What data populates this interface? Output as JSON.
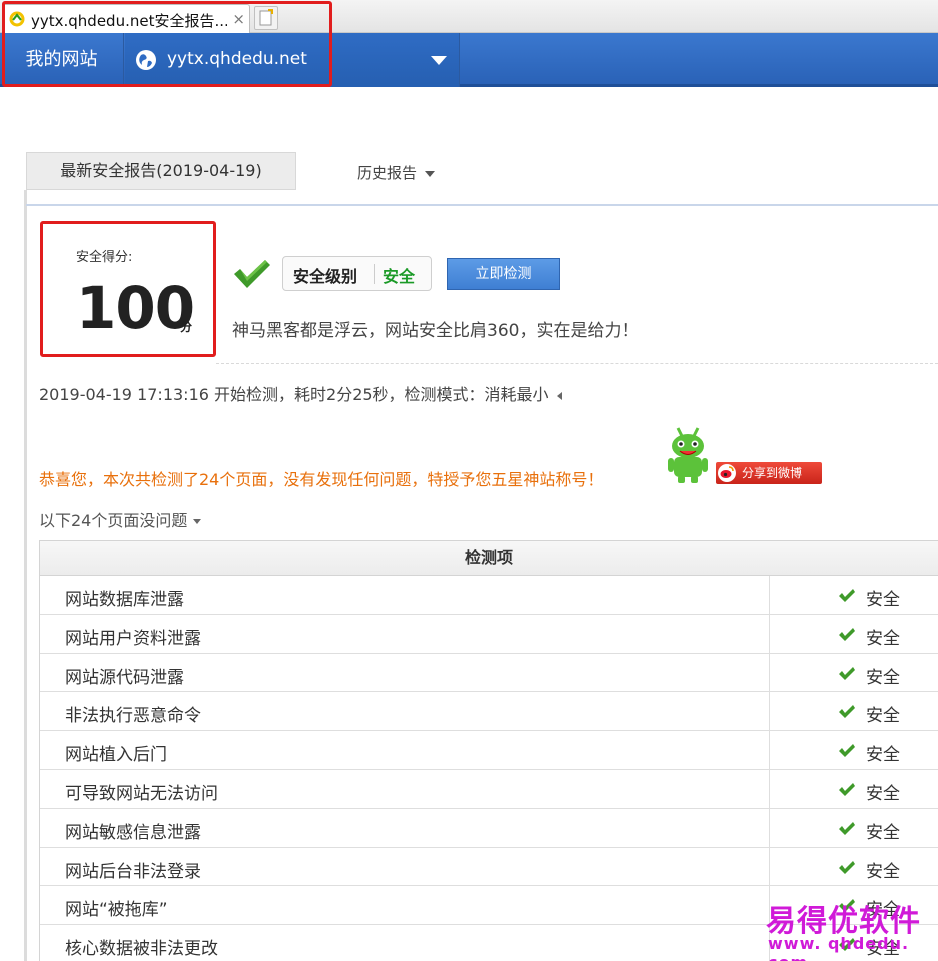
{
  "browser": {
    "tab_title": "yytx.qhdedu.net安全报告...",
    "tab_close": "×"
  },
  "sitebar": {
    "my_site": "我的网站",
    "domain": "yytx.qhdedu.net"
  },
  "report": {
    "latest_tab": "最新安全报告(2019-04-19)",
    "history_tab": "历史报告"
  },
  "score": {
    "label": "安全得分:",
    "value": "100",
    "unit": "分",
    "level_name": "安全级别",
    "level_value": "安全",
    "scan_button": "立即检测",
    "slogan": "神马黑客都是浮云，网站安全比肩360，实在是给力！",
    "level_color": "#1b9a27"
  },
  "scan_info": "2019-04-19 17:13:16 开始检测，耗时2分25秒，检测模式：消耗最小",
  "congrats": "恭喜您，本次共检测了24个页面，没有发现任何问题，特授予您五星神站称号！",
  "share_button": "分享到微博",
  "pages_ok": "以下24个页面没问题",
  "table": {
    "header": "检测项",
    "rows": [
      {
        "name": "网站数据库泄露",
        "status": "安全"
      },
      {
        "name": "网站用户资料泄露",
        "status": "安全"
      },
      {
        "name": "网站源代码泄露",
        "status": "安全"
      },
      {
        "name": "非法执行恶意命令",
        "status": "安全"
      },
      {
        "name": "网站植入后门",
        "status": "安全"
      },
      {
        "name": "可导致网站无法访问",
        "status": "安全"
      },
      {
        "name": "网站敏感信息泄露",
        "status": "安全"
      },
      {
        "name": "网站后台非法登录",
        "status": "安全"
      },
      {
        "name": "网站“被拖库”",
        "status": "安全"
      },
      {
        "name": "核心数据被非法更改",
        "status": "安全"
      }
    ]
  },
  "watermark": {
    "line1": "易得优软件",
    "line2": "www. qhdedu. com"
  },
  "icons": {
    "tab_favicon": "360-favicon-icon",
    "new_tab": "new-tab-icon",
    "globe": "globe-icon",
    "check": "check-icon",
    "mascot": "android-mascot-icon",
    "weibo": "weibo-icon"
  }
}
